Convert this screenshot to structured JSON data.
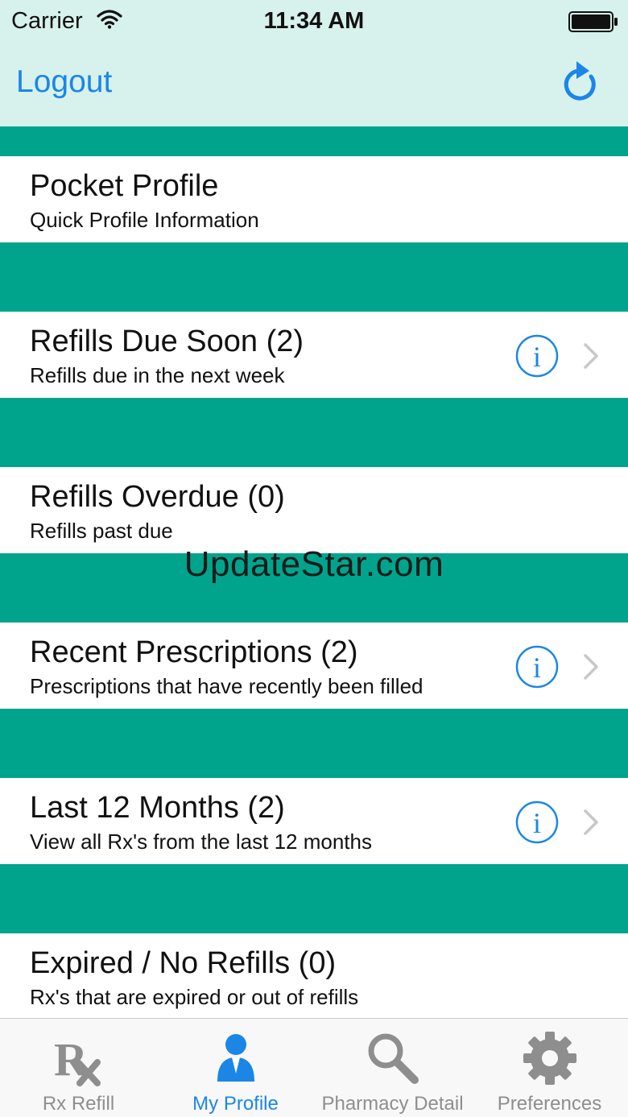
{
  "status_bar": {
    "carrier": "Carrier",
    "time": "11:34 AM",
    "wifi_icon": "wifi-icon",
    "battery_icon": "battery-icon"
  },
  "nav_bar": {
    "logout_label": "Logout",
    "refresh_icon": "refresh-icon"
  },
  "colors": {
    "accent": "#1b86e6",
    "teal": "#00a48c",
    "header_bg": "#d7f1ec",
    "tab_inactive": "#8e8e8e"
  },
  "list": [
    {
      "title": "Pocket Profile",
      "subtitle": "Quick Profile Information",
      "has_info": false
    },
    {
      "title": "Refills Due Soon (2)",
      "subtitle": "Refills due in the next week",
      "has_info": true
    },
    {
      "title": "Refills Overdue (0)",
      "subtitle": "Refills past due",
      "has_info": false
    },
    {
      "title": "Recent Prescriptions (2)",
      "subtitle": "Prescriptions that have recently been filled",
      "has_info": true
    },
    {
      "title": "Last 12 Months (2)",
      "subtitle": "View all Rx's from the last 12 months",
      "has_info": true
    },
    {
      "title": "Expired / No Refills (0)",
      "subtitle": "Rx's that are expired or out of refills",
      "has_info": false
    }
  ],
  "watermark": "UpdateStar.com",
  "tab_bar": {
    "tabs": [
      {
        "label": "Rx Refill",
        "icon": "rx-icon",
        "active": false
      },
      {
        "label": "My Profile",
        "icon": "profile-icon",
        "active": true
      },
      {
        "label": "Pharmacy Detail",
        "icon": "search-icon",
        "active": false
      },
      {
        "label": "Preferences",
        "icon": "gear-icon",
        "active": false
      }
    ]
  }
}
